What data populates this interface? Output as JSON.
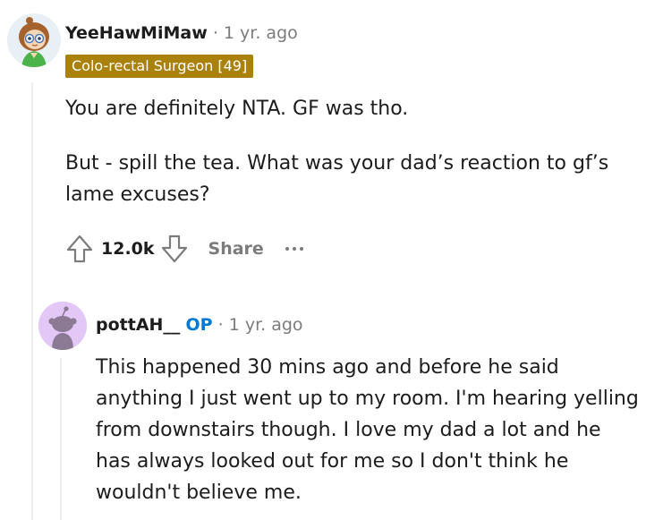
{
  "comment1": {
    "username": "YeeHawMiMaw",
    "separator": "·",
    "time": "1 yr. ago",
    "flair": "Colo-rectal Surgeon [49]",
    "paragraphs": [
      "You are definitely NTA. GF was tho.",
      "But - spill the tea. What was your dad’s reaction to gf’s lame excuses?"
    ],
    "vote_count": "12.0k",
    "share_label": "Share",
    "icons": [
      "upvote-icon",
      "downvote-icon",
      "more-icon"
    ]
  },
  "comment2": {
    "username": "pottAH__",
    "op_badge": "OP",
    "separator": "·",
    "time": "1 yr. ago",
    "paragraphs": [
      "This happened 30 mins ago and before he said anything I just went up to my room. I'm hearing yelling from downstairs though. I love my dad a lot and he has always looked out for me so I don't think he wouldn't believe me."
    ]
  },
  "colors": {
    "flair_bg": "#a9810b",
    "op_blue": "#0079d3",
    "meta_gray": "#7c7c7c",
    "avatar2_bg": "#e2c7f7"
  }
}
